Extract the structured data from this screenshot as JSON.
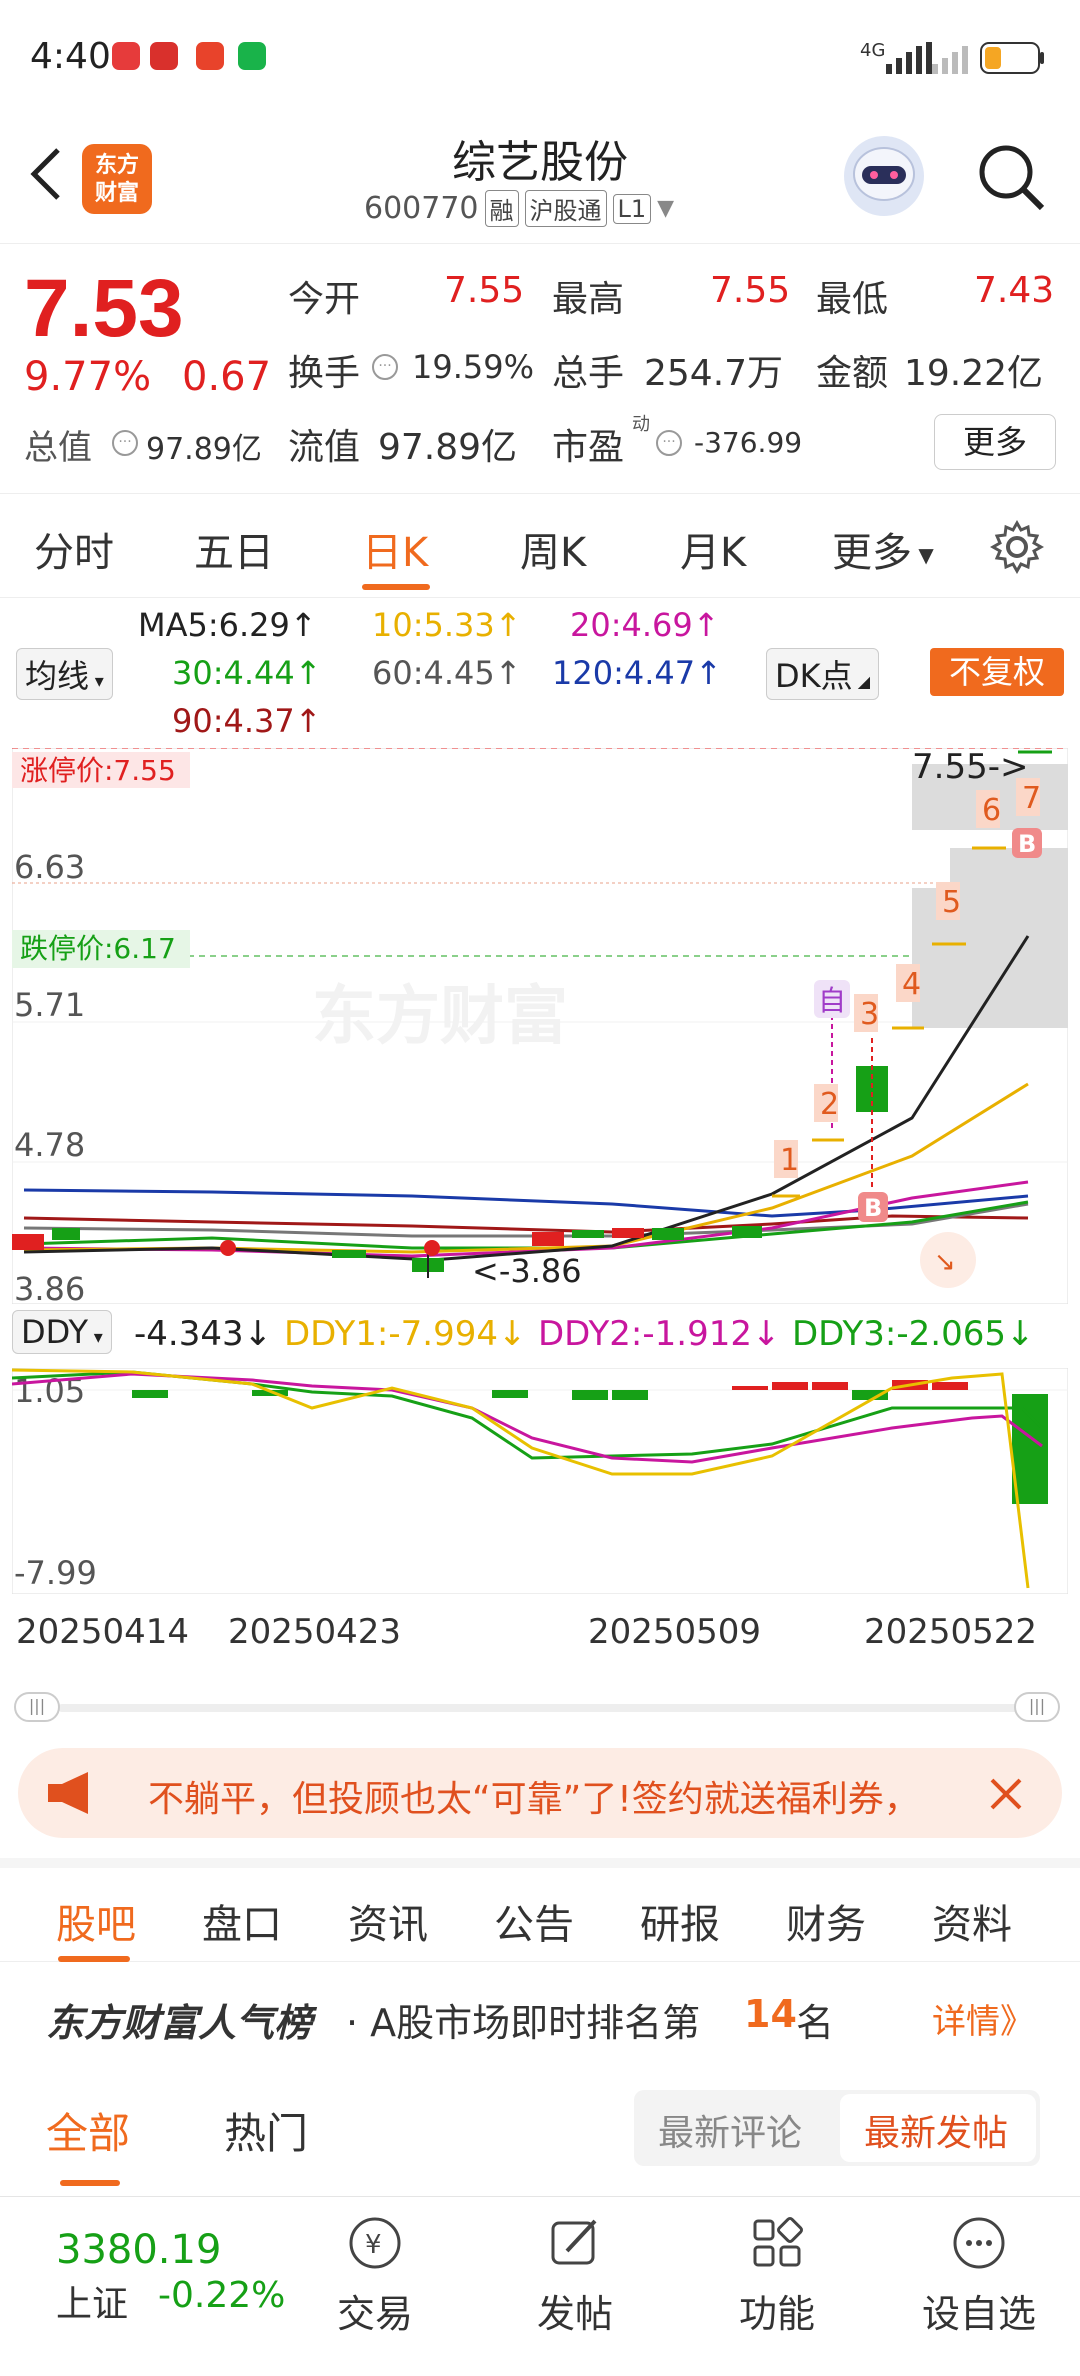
{
  "status_bar": {
    "time": "4:40",
    "network": "4G"
  },
  "header": {
    "logo": "东方财富",
    "title": "综艺股份",
    "code": "600770",
    "tags": [
      "融",
      "沪股通",
      "L1"
    ]
  },
  "quote": {
    "price": "7.53",
    "change_pct": "9.77%",
    "change": "0.67",
    "open_label": "今开",
    "open": "7.55",
    "high_label": "最高",
    "high": "7.55",
    "low_label": "最低",
    "low": "7.43",
    "turnover_label": "换手",
    "turnover": "19.59%",
    "volume_label": "总手",
    "volume": "254.7万",
    "amount_label": "金额",
    "amount": "19.22亿",
    "mktcap_label": "总值",
    "mktcap": "97.89亿",
    "float_label": "流值",
    "float": "97.89亿",
    "pe_label": "市盈",
    "pe_sup": "动",
    "pe": "-376.99",
    "more": "更多"
  },
  "tabs": [
    "分时",
    "五日",
    "日K",
    "周K",
    "月K",
    "更多"
  ],
  "ma": {
    "selector": "均线",
    "ma5": "MA5:6.29↑",
    "ma10": "10:5.33↑",
    "ma20": "20:4.69↑",
    "ma30": "30:4.44↑",
    "ma60": "60:4.45↑",
    "ma120": "120:4.47↑",
    "ma90": "90:4.37↑",
    "dk": "DK点",
    "fuquan": "不复权"
  },
  "chart_labels": {
    "limit_up": "涨停价:7.55",
    "limit_down": "跌停价:6.17",
    "y1": "6.63",
    "y2": "5.71",
    "y3": "4.78",
    "y4": "3.86",
    "last_price_tag": "7.55->",
    "low_tag": "<-3.86",
    "watermark": "东方财富",
    "self_tag": "自",
    "buy_tag": "B",
    "steps": [
      "1",
      "2",
      "3",
      "4",
      "5",
      "6",
      "7"
    ]
  },
  "ddy": {
    "selector": "DDY",
    "ddy": "-4.343↓",
    "ddy1": "DDY1:-7.994↓",
    "ddy2": "DDY2:-1.912↓",
    "ddy3": "DDY3:-2.065↓",
    "ytop": "1.05",
    "ybottom": "-7.99"
  },
  "dates": [
    "20250414",
    "20250423",
    "20250509",
    "20250522"
  ],
  "banner": {
    "text": "不躺平，但投顾也太“可靠”了!签约就送福利券，"
  },
  "sub_tabs": [
    "股吧",
    "盘口",
    "资讯",
    "公告",
    "研报",
    "财务",
    "资料"
  ],
  "rank": {
    "brand": "东方财富人气榜",
    "prefix": "· A股市场即时排名第",
    "num": "14",
    "suffix": "名",
    "detail": "详情》"
  },
  "filter": {
    "all": "全部",
    "hot": "热门",
    "latest_comment": "最新评论",
    "latest_post": "最新发帖"
  },
  "index": {
    "value": "3380.19",
    "name": "上证",
    "change": "-0.22%"
  },
  "nav": [
    "交易",
    "发帖",
    "功能",
    "设自选"
  ],
  "colors": {
    "accent": "#f06a1e",
    "up": "#e02020",
    "down": "#16a016"
  }
}
